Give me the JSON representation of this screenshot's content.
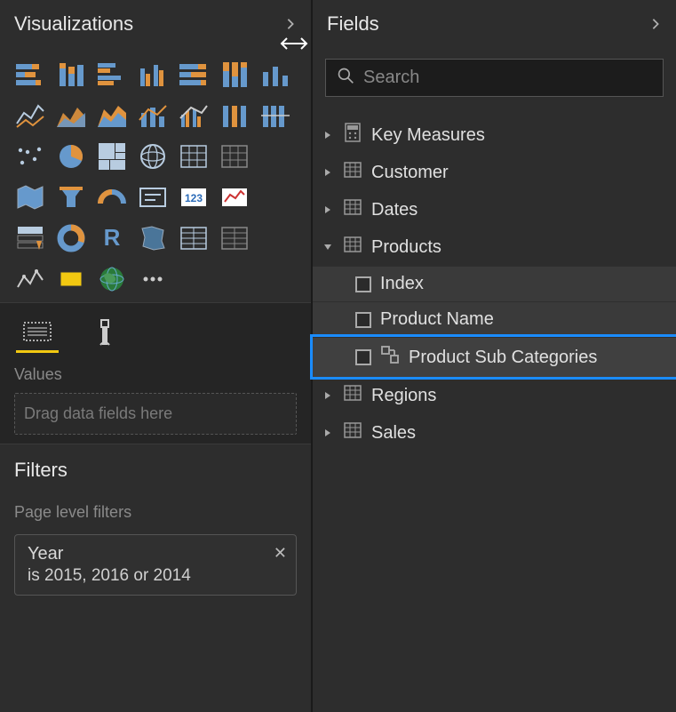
{
  "visualizations": {
    "title": "Visualizations",
    "values_label": "Values",
    "drop_hint": "Drag data fields here"
  },
  "filters": {
    "title": "Filters",
    "page_level_label": "Page level filters",
    "items": [
      {
        "name": "Year",
        "summary": "is 2015, 2016 or 2014"
      }
    ]
  },
  "fields": {
    "title": "Fields",
    "search_placeholder": "Search",
    "tables": [
      {
        "name": "Key Measures",
        "icon": "calculator",
        "expanded": false
      },
      {
        "name": "Customer",
        "icon": "table",
        "expanded": false
      },
      {
        "name": "Dates",
        "icon": "table",
        "expanded": false
      },
      {
        "name": "Products",
        "icon": "table",
        "expanded": true,
        "fields": [
          {
            "name": "Index",
            "type": "field",
            "checked": false,
            "selected": false
          },
          {
            "name": "Product Name",
            "type": "field",
            "checked": false,
            "selected": false
          },
          {
            "name": "Product Sub Categories",
            "type": "hierarchy",
            "checked": false,
            "selected": true
          }
        ]
      },
      {
        "name": "Regions",
        "icon": "table",
        "expanded": false
      },
      {
        "name": "Sales",
        "icon": "table",
        "expanded": false
      }
    ]
  },
  "viz_tiles": [
    "stacked-bar",
    "stacked-column",
    "clustered-bar",
    "clustered-column",
    "100-stacked-bar",
    "100-stacked-column",
    "bar-dual",
    "line",
    "area",
    "stacked-area",
    "combo-line-stacked",
    "combo-line-clustered",
    "ribbon",
    "waterfall-dual",
    "scatter",
    "pie",
    "treemap",
    "globe",
    "table-small",
    "matrix-small",
    "blank",
    "filled-map",
    "funnel",
    "gauge",
    "card",
    "multi-card",
    "kpi",
    "slicer",
    "card-table",
    "donut",
    "r-visual",
    "shape-map",
    "table",
    "matrix",
    "blank2",
    "line-sparse",
    "python",
    "arcgis",
    "more"
  ],
  "colors": {
    "accent": "#f2c811",
    "selection": "#1a8cff",
    "bar_blue": "#6699cc",
    "bar_orange": "#e0933e"
  }
}
